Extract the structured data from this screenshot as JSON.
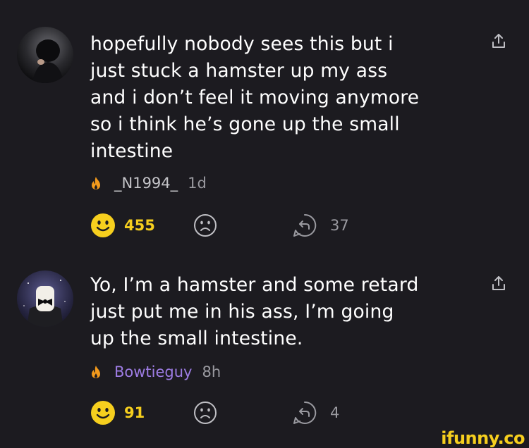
{
  "comments": [
    {
      "text": "hopefully nobody sees this but i\njust stuck a hamster up my ass\nand i don’t feel it moving anymore\nso i think he’s gone up the small\nintestine",
      "username": "_N1994_",
      "time": "1d",
      "likes": "455",
      "replies": "37"
    },
    {
      "text": "Yo, I’m a hamster and some retard\njust put me in his ass, I’m going\nup the small intestine.",
      "username": "Bowtieguy",
      "time": "8h",
      "likes": "91",
      "replies": "4"
    }
  ],
  "brand": "ifunny.co",
  "colors": {
    "background": "#1c1b20",
    "like_yellow": "#f6cf1e",
    "username_purple": "#9d7ce3",
    "muted": "#9a9aa0",
    "fire_orange": "#f39a1c"
  },
  "icons": [
    "share-icon",
    "fire-icon",
    "smile-icon",
    "frown-icon",
    "reply-icon"
  ]
}
